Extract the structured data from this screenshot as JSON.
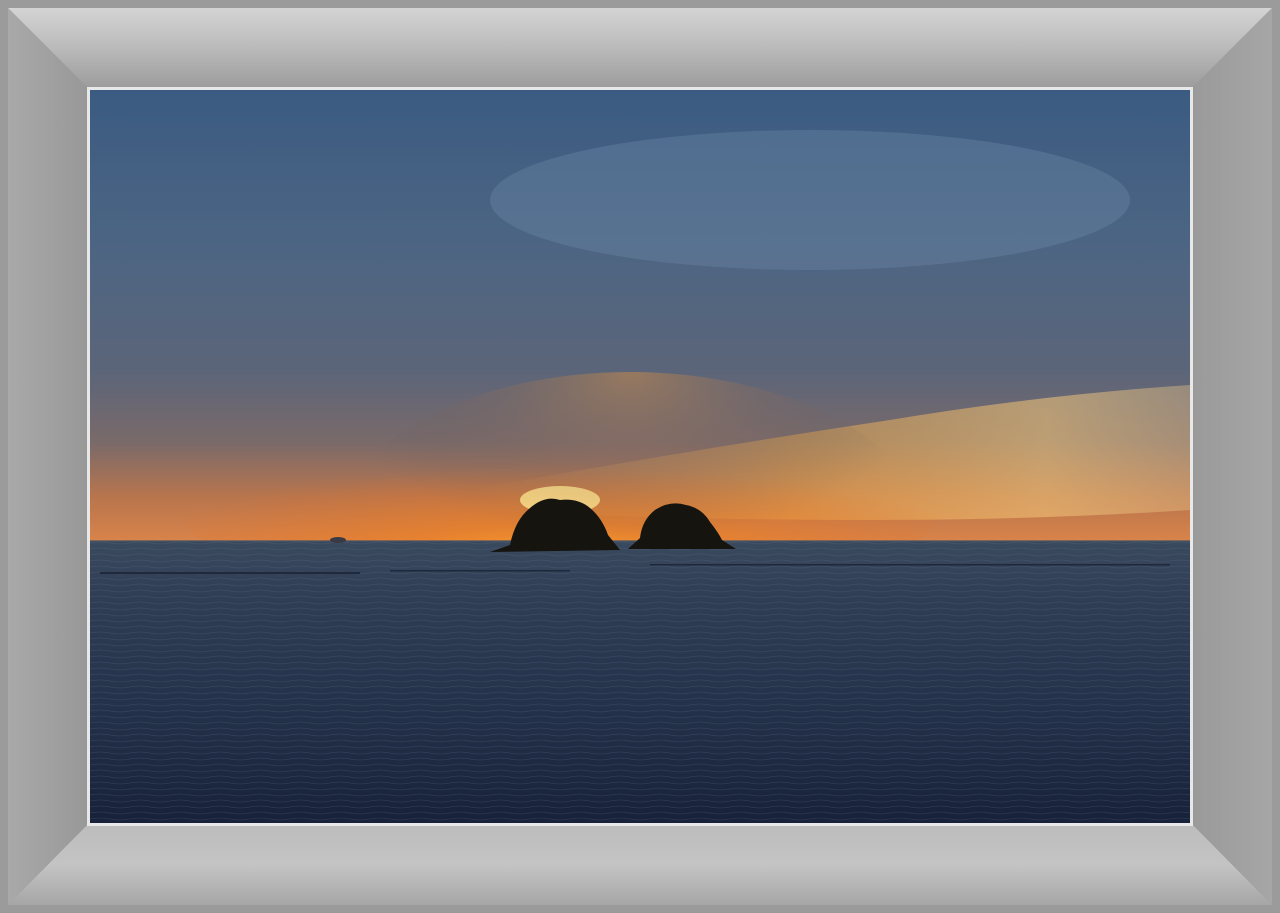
{
  "image": {
    "subject": "sunset-over-sea-with-two-islets",
    "colors": {
      "sky_top": "#3e5f86",
      "sky_mid": "#5a6c86",
      "horizon_glow": "#f28a1e",
      "sun_core": "#ffd25a",
      "sea_top": "#2e3c52",
      "sea_bottom": "#16223a",
      "island": "#15140f",
      "frame": "#9a9a9a",
      "mat": "#e8e8e8"
    }
  }
}
